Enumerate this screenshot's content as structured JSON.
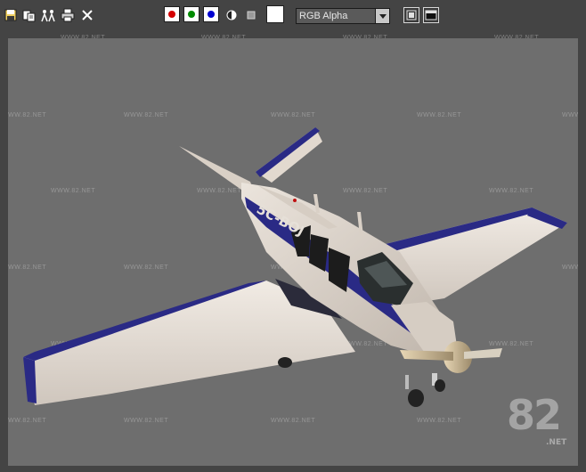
{
  "toolbar": {
    "icons": [
      "save-icon",
      "copy-icon",
      "clone-icon",
      "print-icon",
      "close-icon"
    ],
    "channels": [
      {
        "name": "red-channel",
        "color": "#d40000"
      },
      {
        "name": "green-channel",
        "color": "#008a00"
      },
      {
        "name": "blue-channel",
        "color": "#0000d0"
      }
    ],
    "swatch_color": "#ffffff",
    "channel_select": "RGB Alpha"
  },
  "viewport": {
    "background": "#6e6e6e",
    "tail_registration": "5C-BOJ"
  },
  "watermark": {
    "text": "WWW.82.NET",
    "logo_number": "82",
    "logo_suffix": ".NET"
  }
}
